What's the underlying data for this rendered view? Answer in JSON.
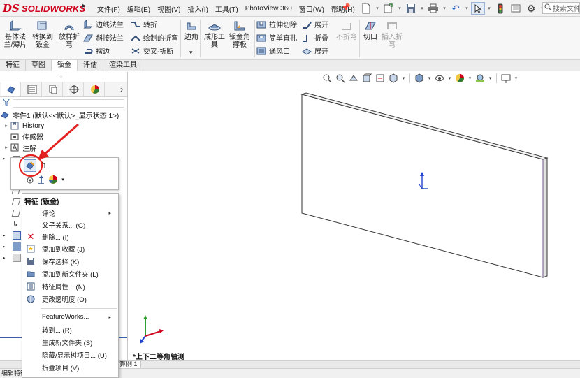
{
  "app": {
    "logo_text": "SOLIDWORKS",
    "logo_mark": "DS",
    "menu": [
      "文件(F)",
      "编辑(E)",
      "视图(V)",
      "插入(I)",
      "工具(T)",
      "PhotoView 360",
      "窗口(W)",
      "帮助(H)"
    ],
    "search_placeholder": "搜索文件",
    "quick_access_icons": [
      "new-document-icon",
      "open-file-icon",
      "save-icon",
      "print-icon",
      "undo-icon",
      "select-pointer-icon",
      "traffic-light-icon",
      "rebuild-icon",
      "options-icon"
    ]
  },
  "ribbon": {
    "big_buttons": [
      {
        "label": "基体法\n兰/薄片",
        "icon": "base-flange-icon",
        "disabled": false
      },
      {
        "label": "转换到\n钣金",
        "icon": "convert-to-sheet-metal-icon",
        "disabled": false
      },
      {
        "label": "放样折\n弯",
        "icon": "lofted-bend-icon",
        "disabled": false
      },
      {
        "label": "边角",
        "icon": "corner-icon",
        "disabled": false
      },
      {
        "label": "成形工\n具",
        "icon": "forming-tool-icon",
        "disabled": false
      },
      {
        "label": "钣金角\n撑板",
        "icon": "sheet-metal-gusset-icon",
        "disabled": false
      },
      {
        "label": "不折弯",
        "icon": "no-bends-icon",
        "disabled": true
      },
      {
        "label": "切口",
        "icon": "rip-icon",
        "disabled": false
      },
      {
        "label": "插入折\n弯",
        "icon": "insert-bends-icon",
        "disabled": true
      }
    ],
    "small_buttons": [
      {
        "label": "边线法兰",
        "icon": "edge-flange-icon"
      },
      {
        "label": "斜接法兰",
        "icon": "miter-flange-icon"
      },
      {
        "label": "褶边",
        "icon": "hem-icon"
      },
      {
        "label": "转折",
        "icon": "jog-icon"
      },
      {
        "label": "绘制的折弯",
        "icon": "sketched-bend-icon"
      },
      {
        "label": "交叉-折断",
        "icon": "cross-break-icon"
      },
      {
        "label": "拉伸切除",
        "icon": "extruded-cut-icon"
      },
      {
        "label": "简单直孔",
        "icon": "simple-hole-icon"
      },
      {
        "label": "通风口",
        "icon": "vent-icon"
      },
      {
        "label": "展开",
        "icon": "unfold-icon"
      },
      {
        "label": "折叠",
        "icon": "fold-icon"
      },
      {
        "label": "展开",
        "icon": "flatten-icon"
      }
    ],
    "corner_dropdown": "▾"
  },
  "tabs": [
    {
      "label": "特征",
      "active": false
    },
    {
      "label": "草图",
      "active": false
    },
    {
      "label": "钣金",
      "active": true
    },
    {
      "label": "评估",
      "active": false
    },
    {
      "label": "渲染工具",
      "active": false
    }
  ],
  "feature_tree": {
    "panel_tabs": [
      "feature-manager-icon",
      "property-manager-icon",
      "configuration-manager-icon",
      "dimxpert-icon",
      "display-manager-icon"
    ],
    "root": "零件1  (默认<<默认>_显示状态 1>)",
    "items": [
      {
        "label": "History",
        "icon": "history-icon",
        "expandable": true
      },
      {
        "label": "传感器",
        "icon": "sensor-icon",
        "expandable": false
      },
      {
        "label": "注解",
        "icon": "annotation-icon",
        "expandable": true
      }
    ]
  },
  "popup_toolbar": {
    "icons": [
      "edit-feature-icon",
      "rollback-icon",
      "appearance-icon",
      "normal-to-icon",
      "suppress-icon"
    ]
  },
  "context_menu": {
    "title": "特征 (钣金)",
    "items": [
      {
        "label": "评论",
        "icon": "",
        "submenu": true
      },
      {
        "label": "父子关系... (G)",
        "icon": "",
        "submenu": false
      },
      {
        "label": "删除... (I)",
        "icon": "delete-x-icon",
        "submenu": false
      },
      {
        "label": "添加到收藏 (J)",
        "icon": "add-favorite-icon",
        "submenu": false
      },
      {
        "label": "保存选择 (K)",
        "icon": "save-selection-icon",
        "submenu": false
      },
      {
        "label": "添加到新文件夹 (L)",
        "icon": "add-folder-icon",
        "submenu": false
      },
      {
        "label": "特征属性... (N)",
        "icon": "feature-properties-icon",
        "submenu": false
      },
      {
        "label": "更改透明度 (O)",
        "icon": "transparency-icon",
        "submenu": false
      },
      {
        "label": "FeatureWorks...",
        "icon": "",
        "submenu": true
      },
      {
        "label": "转到... (R)",
        "icon": "",
        "submenu": false
      },
      {
        "label": "生成新文件夹 (S)",
        "icon": "",
        "submenu": false
      },
      {
        "label": "隐藏/显示树项目... (U)",
        "icon": "",
        "submenu": false
      },
      {
        "label": "折叠项目 (V)",
        "icon": "",
        "submenu": false
      }
    ]
  },
  "viewport": {
    "view_name": "*上下二等角轴测",
    "view_toolbar_icons": [
      "zoom-to-fit-icon",
      "zoom-area-icon",
      "previous-view-icon",
      "section-view-icon",
      "dynamic-annotation-icon",
      "view-orientation-icon",
      "display-style-icon",
      "hide-show-items-icon",
      "edit-appearance-icon",
      "apply-scene-icon",
      "view-settings-icon",
      "monitor-icon"
    ]
  },
  "bottom": {
    "model_tab": "算例 1",
    "status_text": "编辑特征"
  },
  "colors": {
    "logo_red": "#d0021b",
    "annotation_red": "#e52222",
    "selection_blue": "#3b5fae",
    "toolbar_bg": "#f7f7f7"
  }
}
